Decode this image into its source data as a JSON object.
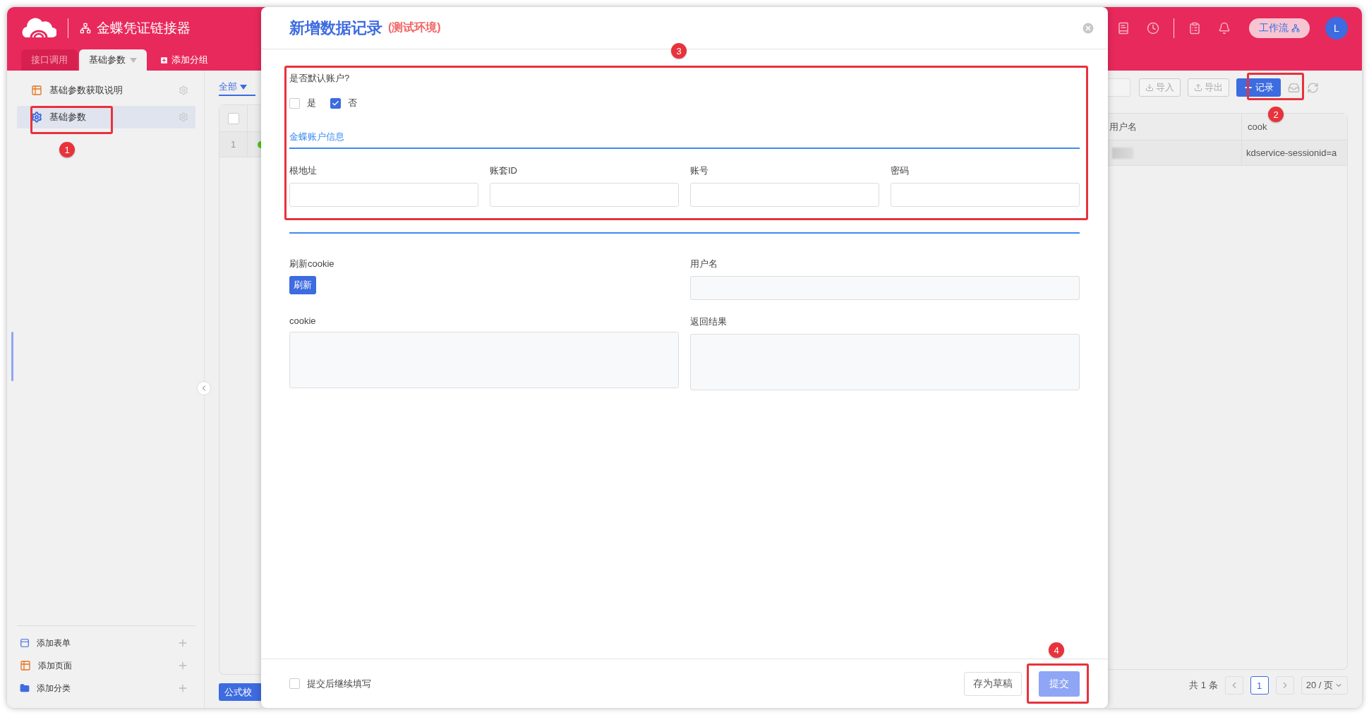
{
  "app": {
    "title": "金蝶凭证链接器",
    "workflow_label": "工作流",
    "avatar": "L"
  },
  "group_tabs": [
    {
      "label": "接口调用",
      "selected": false,
      "dropdown": false
    },
    {
      "label": "基础参数",
      "selected": true,
      "dropdown": true
    }
  ],
  "add_group": "添加分组",
  "sidebar": {
    "items": [
      {
        "label": "基础参数获取说明",
        "kind": "page",
        "selected": false
      },
      {
        "label": "基础参数",
        "kind": "settings",
        "selected": true
      }
    ],
    "footer_items": [
      {
        "label": "添加表单",
        "kind": "form"
      },
      {
        "label": "添加页面",
        "kind": "page"
      },
      {
        "label": "添加分类",
        "kind": "folder"
      }
    ]
  },
  "view_tab": "全部",
  "toolbar": {
    "import": "导入",
    "export": "导出",
    "add_record": "记录"
  },
  "table": {
    "select_all": {
      "checked": false
    },
    "columns": [
      {
        "label": "用户名"
      },
      {
        "label": "cook"
      }
    ],
    "rows": [
      {
        "index": "1",
        "color": "#52c41a",
        "column_2": "kdservice-sessionid=a"
      }
    ]
  },
  "formula_button": "公式校",
  "pagination": {
    "total": "共 1 条",
    "pages": [
      {
        "label": "1",
        "selected": true
      }
    ],
    "page_size": "20 / 页"
  },
  "modal": {
    "title": "新增数据记录",
    "subtitle": "(测试环境)",
    "default_account": {
      "label": "是否默认账户?",
      "options": [
        {
          "label": "是",
          "checked": false
        },
        {
          "label": "否",
          "checked": true
        }
      ]
    },
    "section": "金蝶账户信息",
    "fields": [
      {
        "label": "根地址"
      },
      {
        "label": "账套ID"
      },
      {
        "label": "账号"
      },
      {
        "label": "密码"
      }
    ],
    "refresh": {
      "label": "刷新cookie",
      "button": "刷新"
    },
    "username": {
      "label": "用户名"
    },
    "textareas": [
      {
        "label": "cookie"
      },
      {
        "label": "返回结果"
      }
    ],
    "continue": {
      "label": "提交后继续填写",
      "checked": false
    },
    "draft_button": "存为草稿",
    "submit_button": "提交"
  },
  "annotations": [
    {
      "number": "1"
    },
    {
      "number": "2"
    },
    {
      "number": "3"
    },
    {
      "number": "4"
    }
  ]
}
